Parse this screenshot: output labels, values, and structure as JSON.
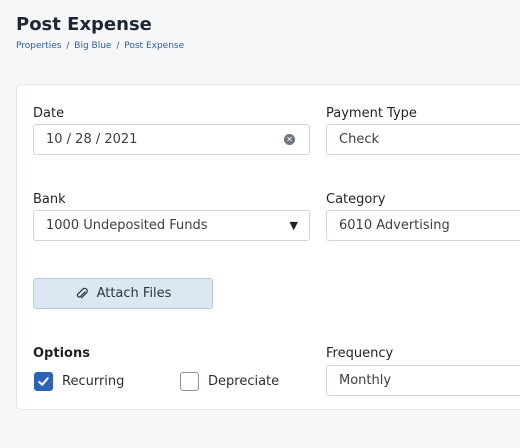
{
  "header": {
    "title": "Post Expense",
    "breadcrumb": [
      "Properties",
      "Big Blue",
      "Post Expense"
    ],
    "breadcrumb_sep": "/"
  },
  "form": {
    "date": {
      "label": "Date",
      "value": "10 / 28 / 2021"
    },
    "payment_type": {
      "label": "Payment Type",
      "value": "Check"
    },
    "bank": {
      "label": "Bank",
      "value": "1000 Undeposited Funds"
    },
    "category": {
      "label": "Category",
      "value": "6010 Advertising"
    },
    "attach_label": "Attach Files",
    "options": {
      "label": "Options",
      "recurring": {
        "label": "Recurring",
        "checked": true
      },
      "depreciate": {
        "label": "Depreciate",
        "checked": false
      }
    },
    "frequency": {
      "label": "Frequency",
      "value": "Monthly"
    }
  },
  "icons": {
    "clear": "clear-circle-icon",
    "dropdown": "caret-down-icon",
    "attach": "paperclip-icon",
    "check": "checkmark-icon"
  },
  "colors": {
    "accent": "#2c63b5",
    "link": "#2f5f9a",
    "button_bg": "#dde7f3"
  }
}
